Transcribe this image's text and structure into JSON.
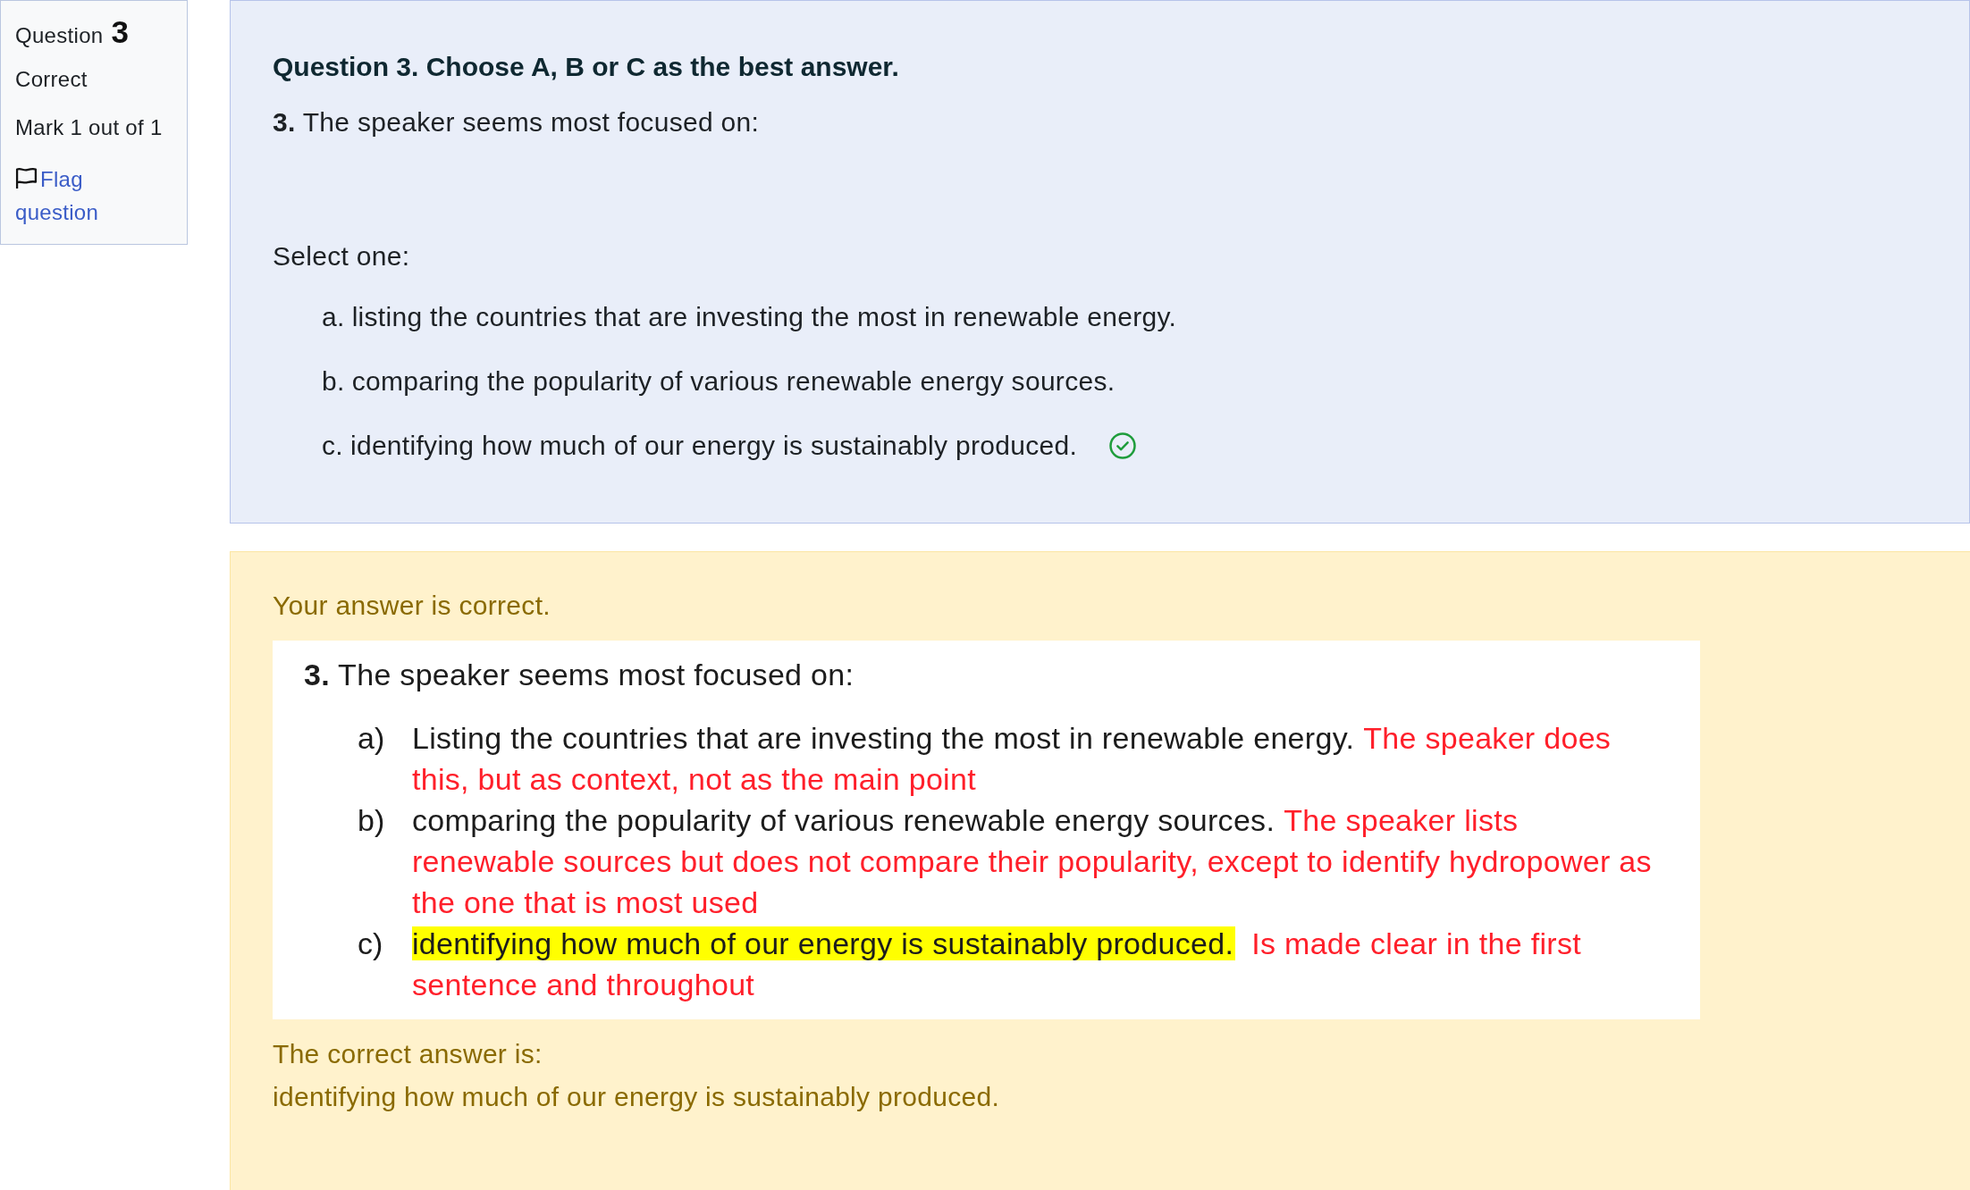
{
  "question_info": {
    "label": "Question",
    "number": "3",
    "state": "Correct",
    "mark": "Mark 1 out of 1",
    "flag_link": "Flag question",
    "flagged": false
  },
  "question": {
    "heading": "Question 3. Choose A, B or C as the best answer.",
    "prompt": "**3.** The speaker seems most focused on:",
    "select_label": "Select one:",
    "options": [
      {
        "letter": "a.",
        "text": "listing the countries that are investing the most in renewable energy.",
        "correct": false
      },
      {
        "letter": "b.",
        "text": "comparing the popularity of various renewable energy sources.",
        "correct": false
      },
      {
        "letter": "c.",
        "text": "identifying how much of our energy is sustainably produced.",
        "correct": true
      }
    ]
  },
  "feedback": {
    "status": "Your answer is correct.",
    "document": {
      "prompt": "**3.** The speaker seems most focused on:",
      "items": [
        {
          "letter": "a)",
          "text": "Listing the countries that are investing the most in renewable energy.",
          "comment": "The speaker does this, but as context, not as the main point",
          "highlighted": false
        },
        {
          "letter": "b)",
          "text": "comparing the popularity of various renewable energy sources.",
          "comment": "The speaker lists renewable sources but does not compare their popularity, except to identify hydropower as the one that is most used",
          "highlighted": false
        },
        {
          "letter": "c)",
          "text": "identifying how much of our energy is sustainably produced.",
          "comment": "Is made clear in the first sentence and throughout",
          "highlighted": true
        }
      ]
    },
    "correct_answer_label": "The correct answer is:",
    "correct_answer": "identifying how much of our energy is sustainably produced."
  }
}
